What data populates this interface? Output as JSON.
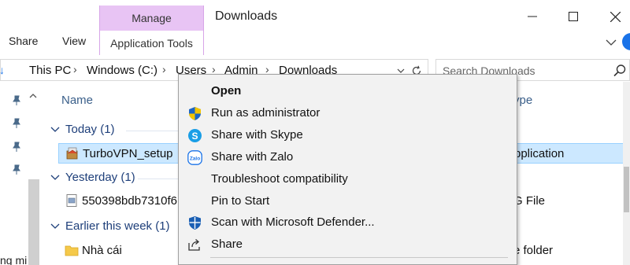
{
  "window": {
    "title": "Downloads"
  },
  "ribbon": {
    "tabs": [
      "Share",
      "View"
    ],
    "contextual_group": "Manage",
    "contextual_tab": "Application Tools"
  },
  "address": {
    "crumbs": [
      "This PC",
      "Windows (C:)",
      "Users",
      "Admin",
      "Downloads"
    ]
  },
  "search": {
    "placeholder": "Search Downloads"
  },
  "nav": {
    "cut_text": "ng mi"
  },
  "file_list": {
    "columns": {
      "name": "Name",
      "type_partial": "ype"
    },
    "groups": [
      {
        "label": "Today (1)"
      },
      {
        "label": "Yesterday (1)"
      },
      {
        "label": "Earlier this week (1)"
      }
    ],
    "rows": [
      {
        "name": "TurboVPN_setup",
        "type": "pplication",
        "selected": true,
        "icon": "installer-icon"
      },
      {
        "name": "550398bdb7310f6",
        "type": "G File",
        "selected": false,
        "icon": "image-file-icon"
      },
      {
        "name": "Nhà cái",
        "type": "e folder",
        "selected": false,
        "icon": "folder-icon"
      }
    ]
  },
  "context_menu": {
    "items": [
      {
        "label": "Open",
        "icon": "",
        "bold": true
      },
      {
        "label": "Run as administrator",
        "icon": "uac-shield-icon",
        "bold": false
      },
      {
        "label": "Share with Skype",
        "icon": "skype-icon",
        "bold": false
      },
      {
        "label": "Share with Zalo",
        "icon": "zalo-icon",
        "bold": false
      },
      {
        "label": "Troubleshoot compatibility",
        "icon": "",
        "bold": false
      },
      {
        "label": "Pin to Start",
        "icon": "",
        "bold": false
      },
      {
        "label": "Scan with Microsoft Defender...",
        "icon": "defender-icon",
        "bold": false
      },
      {
        "label": "Share",
        "icon": "share-icon",
        "bold": false
      }
    ]
  },
  "colors": {
    "manage_tab": "#e8c4f4",
    "selection": "#cce8ff",
    "group_header": "#1e3f7a",
    "menu_background": "#f2f2f2"
  }
}
